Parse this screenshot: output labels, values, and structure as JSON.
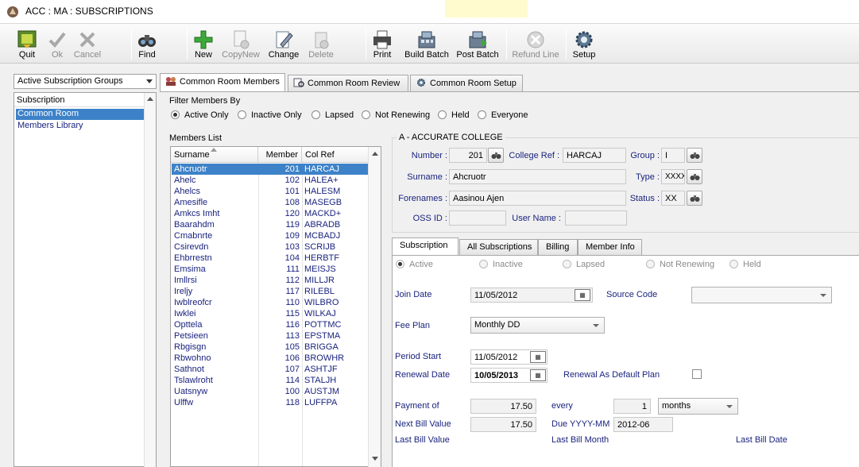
{
  "window": {
    "title": "ACC : MA : SUBSCRIPTIONS"
  },
  "toolbar": {
    "quit": "Quit",
    "ok": "Ok",
    "cancel": "Cancel",
    "find": "Find",
    "new": "New",
    "copynew": "CopyNew",
    "change": "Change",
    "delete": "Delete",
    "print": "Print",
    "build_batch": "Build Batch",
    "post_batch": "Post Batch",
    "refund_line": "Refund Line",
    "setup": "Setup"
  },
  "left_panel": {
    "group_select": "Active Subscription Groups",
    "tree_header": "Subscription",
    "items": [
      "Common Room",
      "Members Library"
    ]
  },
  "tabs": [
    "Common Room Members",
    "Common Room Review",
    "Common Room Setup"
  ],
  "filter": {
    "label": "Filter Members By",
    "options": [
      "Active Only",
      "Inactive Only",
      "Lapsed",
      "Not Renewing",
      "Held",
      "Everyone"
    ],
    "selected": "Active Only"
  },
  "members_list": {
    "label": "Members List",
    "columns": [
      "Surname",
      "Member",
      "Col Ref"
    ],
    "rows": [
      {
        "surname": "Ahcruotr",
        "member": "201",
        "colref": "HARCAJ"
      },
      {
        "surname": "Ahelc",
        "member": "102",
        "colref": "HALEA+"
      },
      {
        "surname": "Ahelcs",
        "member": "101",
        "colref": "HALESM"
      },
      {
        "surname": "Amesifle",
        "member": "108",
        "colref": "MASEGB"
      },
      {
        "surname": "Amkcs Imht",
        "member": "120",
        "colref": "MACKD+"
      },
      {
        "surname": "Baarahdm",
        "member": "119",
        "colref": "ABRADB"
      },
      {
        "surname": "Cmabnrte",
        "member": "109",
        "colref": "MCBADJ"
      },
      {
        "surname": "Csirevdn",
        "member": "103",
        "colref": "SCRIJB"
      },
      {
        "surname": "Ehbrrestn",
        "member": "104",
        "colref": "HERBTF"
      },
      {
        "surname": "Emsima",
        "member": "111",
        "colref": "MEISJS"
      },
      {
        "surname": "Imllrsi",
        "member": "112",
        "colref": "MILLJR"
      },
      {
        "surname": "Ireljy",
        "member": "117",
        "colref": "RILEBL"
      },
      {
        "surname": "Iwblreofcr",
        "member": "110",
        "colref": "WILBRO"
      },
      {
        "surname": "Iwklei",
        "member": "115",
        "colref": "WILKAJ"
      },
      {
        "surname": "Opttela",
        "member": "116",
        "colref": "POTTMC"
      },
      {
        "surname": "Petsieen",
        "member": "113",
        "colref": "EPSTMA"
      },
      {
        "surname": "Rbgisgn",
        "member": "105",
        "colref": "BRIGGA"
      },
      {
        "surname": "Rbwohno",
        "member": "106",
        "colref": "BROWHR"
      },
      {
        "surname": "Sathnot",
        "member": "107",
        "colref": "ASHTJF"
      },
      {
        "surname": "Tslawlroht",
        "member": "114",
        "colref": "STALJH"
      },
      {
        "surname": "Uatsnyw",
        "member": "100",
        "colref": "AUSTJM"
      },
      {
        "surname": "Ulffw",
        "member": "118",
        "colref": "LUFFPA"
      }
    ]
  },
  "details": {
    "group_title": "A - ACCURATE COLLEGE",
    "number_label": "Number :",
    "number": "201",
    "college_ref_label": "College Ref :",
    "college_ref": "HARCAJ",
    "group_label": "Group :",
    "group": "I",
    "surname_label": "Surname :",
    "surname": "Ahcruotr",
    "type_label": "Type :",
    "type": "XXXX",
    "forenames_label": "Forenames :",
    "forenames": "Aasinou Ajen",
    "status_label": "Status :",
    "status": "XX",
    "oss_id_label": "OSS ID :",
    "oss_id": "",
    "user_name_label": "User Name :",
    "user_name": ""
  },
  "sub_tabs": [
    "Subscription",
    "All Subscriptions",
    "Billing",
    "Member Info"
  ],
  "subscription": {
    "status_options": [
      "Active",
      "Inactive",
      "Lapsed",
      "Not Renewing",
      "Held"
    ],
    "join_date_label": "Join Date",
    "join_date": "11/05/2012",
    "source_code_label": "Source Code",
    "source_code": "",
    "fee_plan_label": "Fee Plan",
    "fee_plan": "Monthly DD",
    "period_start_label": "Period Start",
    "period_start": "11/05/2012",
    "renewal_date_label": "Renewal Date",
    "renewal_date": "10/05/2013",
    "renewal_default_label": "Renewal As Default Plan",
    "payment_of_label": "Payment of",
    "payment_of": "17.50",
    "every_label": "every",
    "every": "1",
    "every_unit": "months",
    "next_bill_label": "Next Bill Value",
    "next_bill": "17.50",
    "due_label": "Due YYYY-MM",
    "due": "2012-06",
    "last_bill_value_label": "Last Bill Value",
    "last_bill_month_label": "Last Bill Month",
    "last_bill_date_label": "Last Bill Date"
  }
}
